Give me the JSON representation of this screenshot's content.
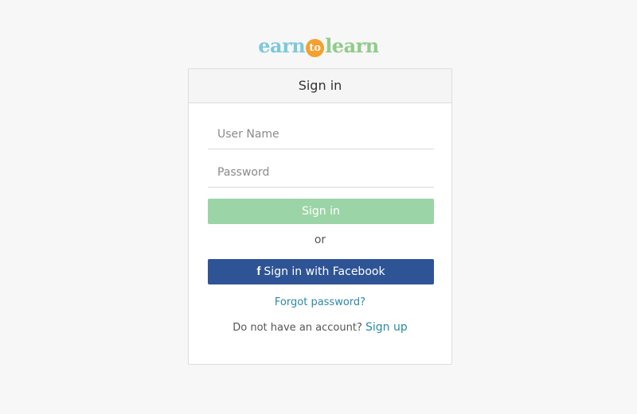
{
  "logo": {
    "part1": "earn",
    "part2": "to",
    "part3": "learn"
  },
  "panel": {
    "title": "Sign in"
  },
  "form": {
    "username_placeholder": "User Name",
    "password_placeholder": "Password",
    "signin_label": "Sign in",
    "or_text": "or",
    "facebook_icon": "f",
    "facebook_label": "Sign in with Facebook",
    "forgot_label": "Forgot password?",
    "no_account_text": "Do not have an account?",
    "signup_label": "Sign up"
  },
  "colors": {
    "background": "#f7f7f7",
    "signin_button": "#9bd4a6",
    "facebook_button": "#2f5496",
    "link": "#2a89a8",
    "logo_earn": "#7dc8dc",
    "logo_to": "#f5a02e",
    "logo_learn": "#8fcc8a"
  }
}
